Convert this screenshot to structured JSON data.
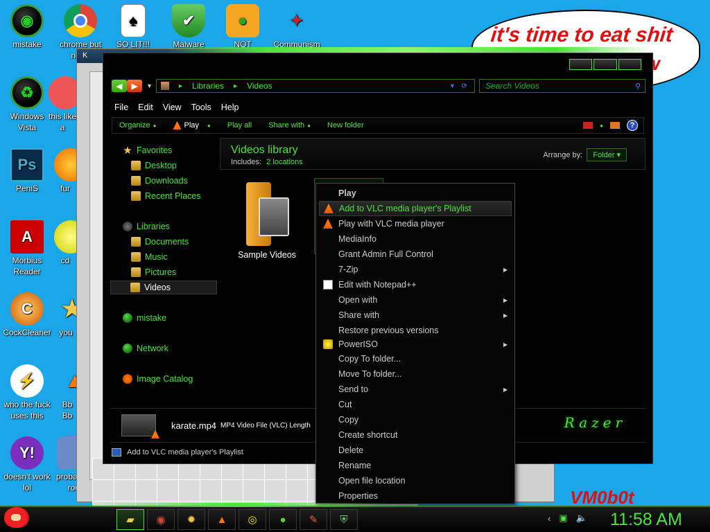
{
  "desktop": {
    "icons": [
      {
        "label": "mistake"
      },
      {
        "label": "chrome but norm"
      },
      {
        "label": "SO LIT!!!"
      },
      {
        "label": "Malware"
      },
      {
        "label": "NOT"
      },
      {
        "label": "Communism"
      },
      {
        "label": "Windows Vista"
      },
      {
        "label": "this like a"
      },
      {
        "label": "PeniS"
      },
      {
        "label": "fur"
      },
      {
        "label": "Morbius Reader"
      },
      {
        "label": "cd"
      },
      {
        "label": "CockCleaner"
      },
      {
        "label": "you"
      },
      {
        "label": "who the fuck uses this"
      },
      {
        "label": "Bb Bb"
      },
      {
        "label": "doesn't work lol"
      },
      {
        "label": "probabl a roc"
      }
    ],
    "bubble_text": "it's time to eat shit",
    "bubble_text_2": "w",
    "corner_text": "VM0b0t",
    "back_window_title": "K"
  },
  "explorer": {
    "breadcrumb": [
      "Libraries",
      "Videos"
    ],
    "search_placeholder": "Search Videos",
    "menu": [
      "File",
      "Edit",
      "View",
      "Tools",
      "Help"
    ],
    "toolbar": {
      "organize": "Organize",
      "play": "Play",
      "play_all": "Play all",
      "share_with": "Share with",
      "new_folder": "New folder"
    },
    "sidebar": {
      "favorites": "Favorites",
      "desktop": "Desktop",
      "downloads": "Downloads",
      "recent_places": "Recent Places",
      "libraries": "Libraries",
      "documents": "Documents",
      "music": "Music",
      "pictures": "Pictures",
      "videos": "Videos",
      "mistake": "mistake",
      "network": "Network",
      "image_catalog": "Image Catalog"
    },
    "library": {
      "title": "Videos library",
      "includes_label": "Includes:",
      "includes_value": "2 locations",
      "arrange_label": "Arrange by:",
      "arrange_value": "Folder"
    },
    "files": [
      {
        "name": "Sample Videos"
      }
    ],
    "details": {
      "filename": "karate.mp4",
      "info": "MP4 Video File (VLC) Length"
    },
    "brand": "Razer",
    "status_text": "Add to VLC media player's Playlist"
  },
  "context_menu": {
    "items": [
      {
        "label": "Play",
        "bold": true
      },
      {
        "label": "Add to VLC media player's Playlist",
        "highlighted": true,
        "icon": "vlc-icon"
      },
      {
        "label": "Play with VLC media player",
        "icon": "vlc-icon"
      },
      {
        "label": "MediaInfo"
      },
      {
        "label": "Grant Admin Full Control"
      },
      {
        "label": "7-Zip",
        "submenu": true
      },
      {
        "label": "Edit with Notepad++",
        "icon": "notepad-icon"
      },
      {
        "label": "Open with",
        "submenu": true
      },
      {
        "label": "Share with",
        "submenu": true
      },
      {
        "label": "Restore previous versions"
      },
      {
        "label": "PowerISO",
        "submenu": true,
        "icon": "poweriso-icon"
      },
      {
        "label": "Copy To folder..."
      },
      {
        "label": "Move To folder..."
      },
      {
        "label": "Send to",
        "submenu": true
      },
      {
        "label": "Cut"
      },
      {
        "label": "Copy"
      },
      {
        "label": "Create shortcut"
      },
      {
        "label": "Delete"
      },
      {
        "label": "Rename"
      },
      {
        "label": "Open file location"
      },
      {
        "label": "Properties"
      }
    ]
  },
  "taskbar": {
    "clock": "11:58 AM",
    "buttons": [
      "explorer-icon",
      "chrome-icon",
      "gear-icon",
      "vlc-icon",
      "disc-icon",
      "pig-icon",
      "brush-icon",
      "shield-icon"
    ]
  },
  "colors": {
    "accent": "#4de23b",
    "desktop_bg": "#1aa6e8",
    "window_bg": "#000000",
    "bubble_text": "#e01010"
  }
}
